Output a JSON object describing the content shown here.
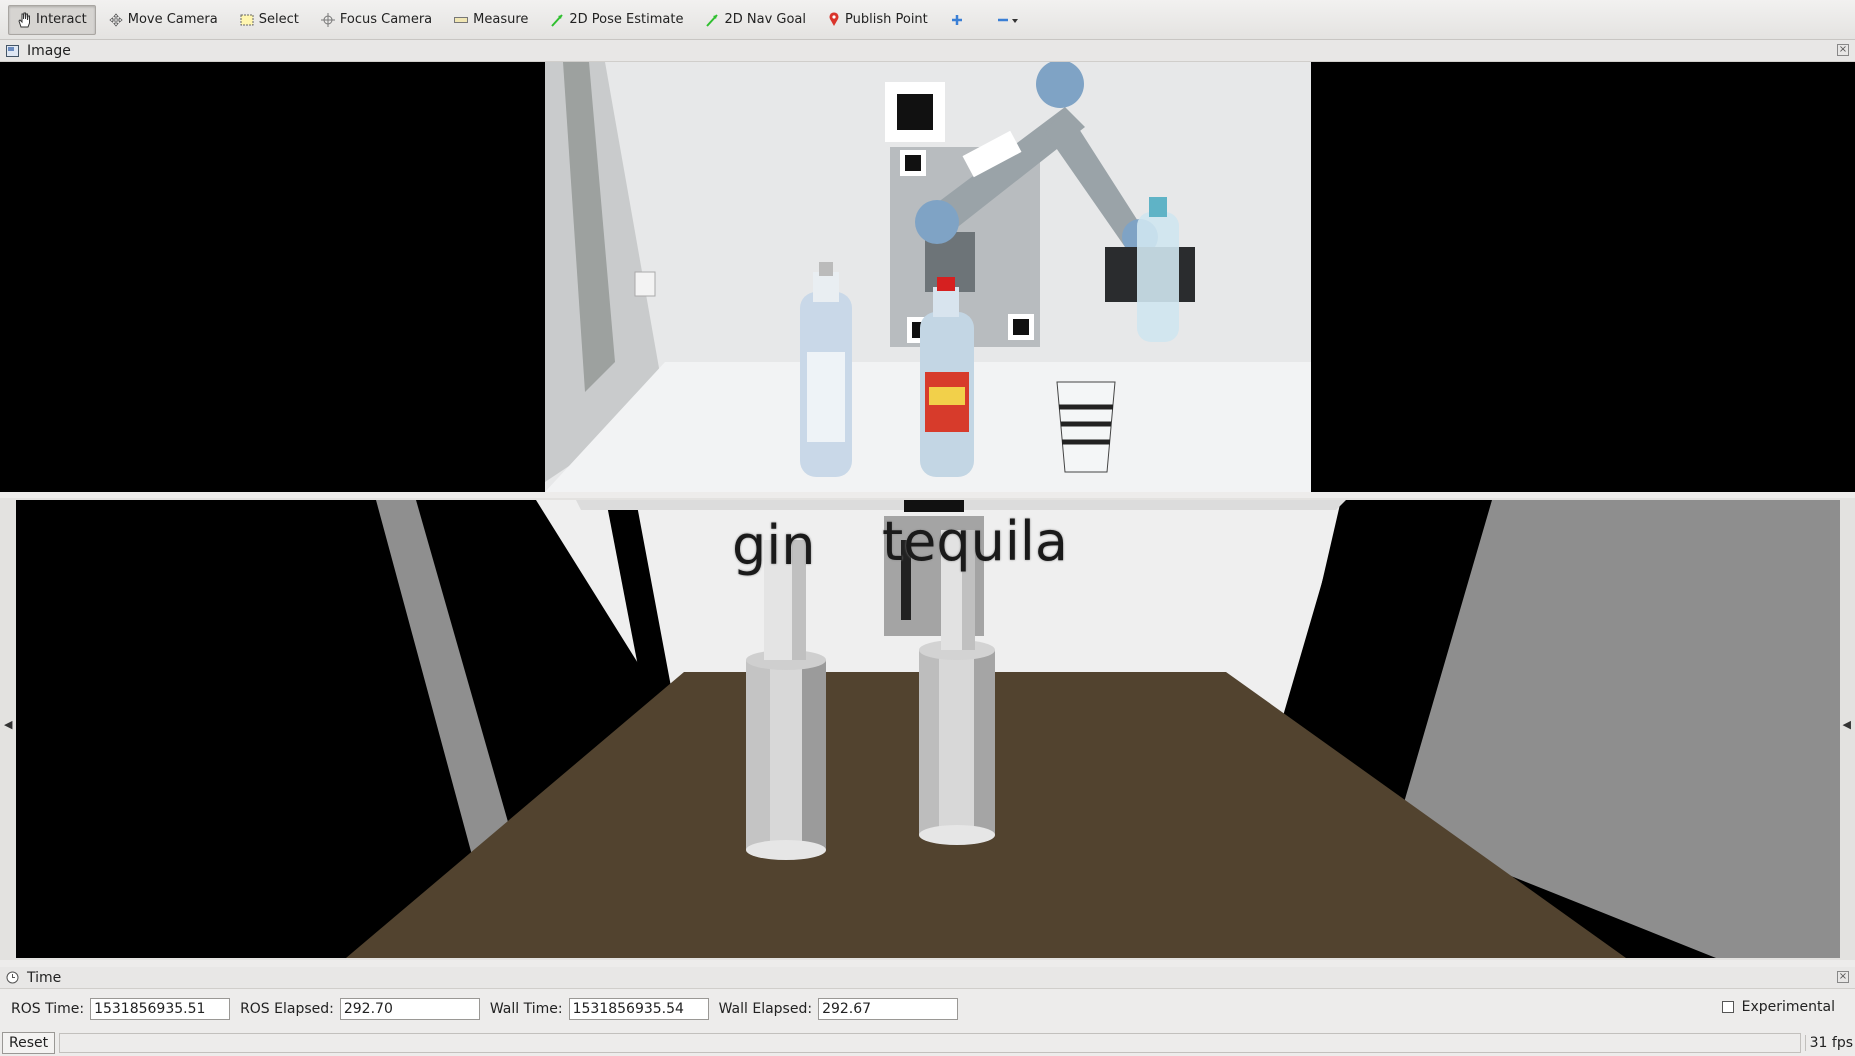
{
  "toolbar": {
    "tools": [
      {
        "label": "Interact",
        "icon": "hand-icon",
        "active": true
      },
      {
        "label": "Move Camera",
        "icon": "move-camera-icon"
      },
      {
        "label": "Select",
        "icon": "select-box-icon"
      },
      {
        "label": "Focus Camera",
        "icon": "focus-crosshair-icon"
      },
      {
        "label": "Measure",
        "icon": "ruler-icon"
      },
      {
        "label": "2D Pose Estimate",
        "icon": "green-arrow-icon"
      },
      {
        "label": "2D Nav Goal",
        "icon": "green-arrow-icon"
      },
      {
        "label": "Publish Point",
        "icon": "map-pin-icon"
      }
    ],
    "add_icon": "plus-icon",
    "remove_icon": "minus-dropdown-icon"
  },
  "image_panel": {
    "title": "Image"
  },
  "view3d": {
    "labels": [
      "gin",
      "tequila"
    ],
    "colors": {
      "table": "#52432f",
      "wall": "#efefef",
      "side_wall": "#8e8e8e"
    }
  },
  "time_panel": {
    "title": "Time",
    "ros_time_label": "ROS Time:",
    "ros_time": "1531856935.51",
    "ros_elapsed_label": "ROS Elapsed:",
    "ros_elapsed": "292.70",
    "wall_time_label": "Wall Time:",
    "wall_time": "1531856935.54",
    "wall_elapsed_label": "Wall Elapsed:",
    "wall_elapsed": "292.67",
    "experimental_label": "Experimental"
  },
  "status": {
    "reset_label": "Reset",
    "fps": "31 fps"
  }
}
